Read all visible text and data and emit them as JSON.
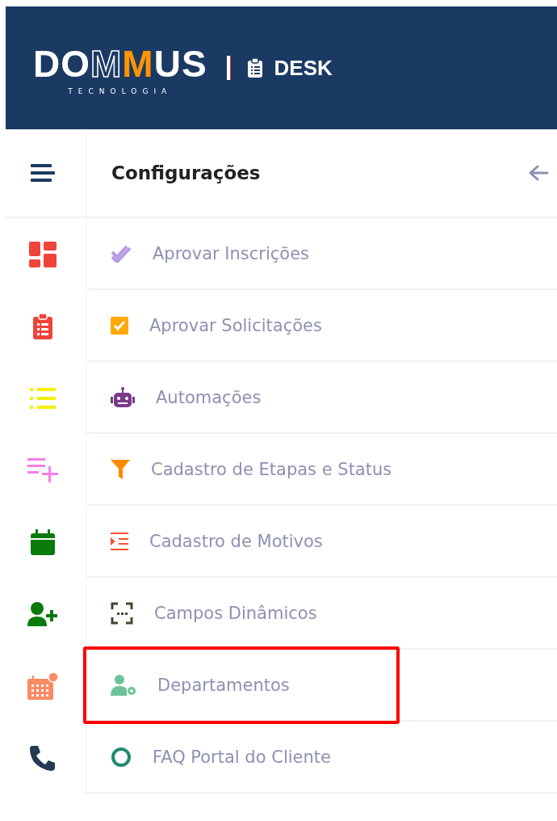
{
  "header": {
    "logo_text": "DOMMUS",
    "logo_subtitle": "TECNOLOGIA",
    "app_name": "DESK"
  },
  "panel": {
    "title": "Configurações"
  },
  "menu_items": [
    {
      "label": "Aprovar Inscrições",
      "highlighted": false
    },
    {
      "label": "Aprovar Solicitações",
      "highlighted": false
    },
    {
      "label": "Automações",
      "highlighted": false
    },
    {
      "label": "Cadastro de Etapas e Status",
      "highlighted": false
    },
    {
      "label": "Cadastro de Motivos",
      "highlighted": false
    },
    {
      "label": "Campos Dinâmicos",
      "highlighted": false
    },
    {
      "label": "Departamentos",
      "highlighted": true
    },
    {
      "label": "FAQ Portal do Cliente",
      "highlighted": false
    }
  ]
}
